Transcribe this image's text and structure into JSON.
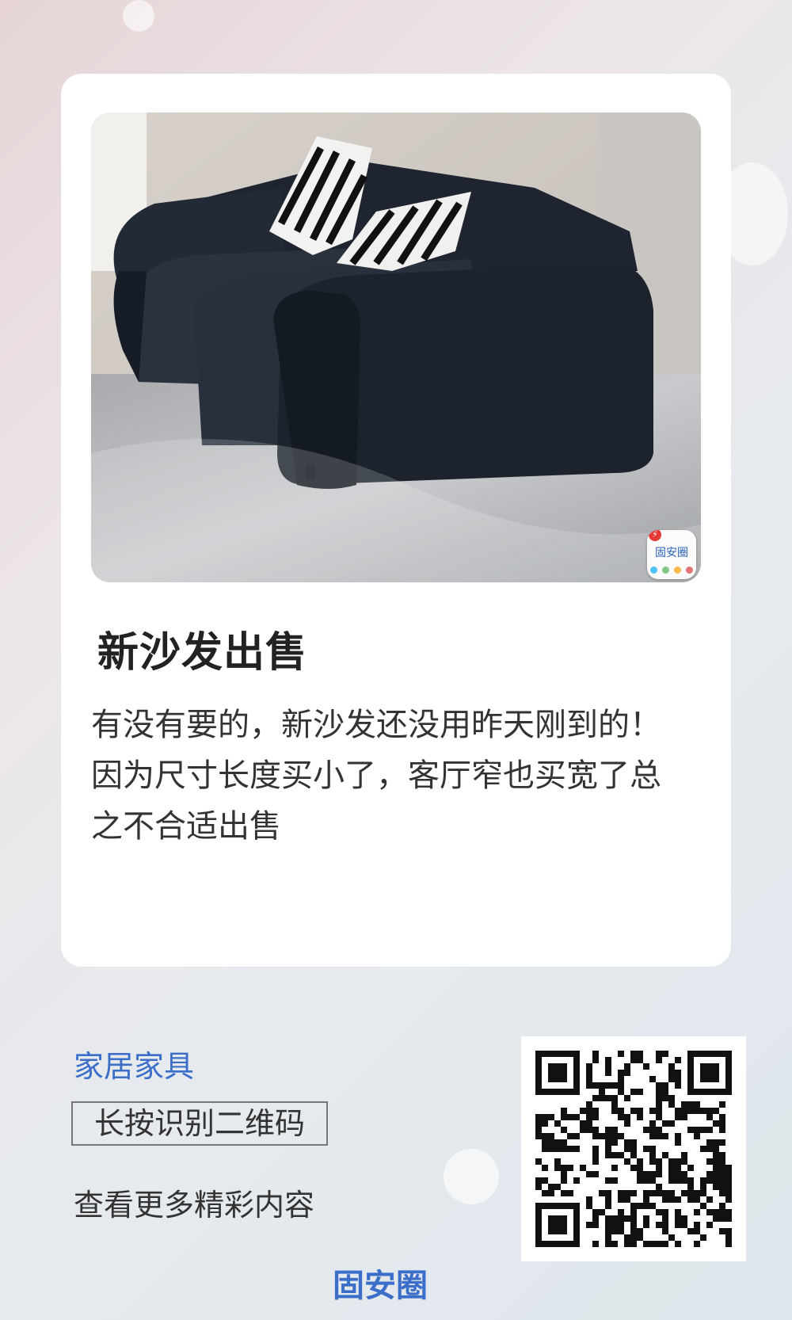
{
  "post": {
    "title": "新沙发出售",
    "description": "有没有要的，新沙发还没用昨天刚到的！因为尺寸长度买小了，客厅窄也买宽了总之不合适出售",
    "image_alt": "black leather sofa with zebra-print cushions"
  },
  "watermark": {
    "app_name": "固安圈"
  },
  "footer": {
    "category": "家居家具",
    "scan_hint": "长按识别二维码",
    "more_text": "查看更多精彩内容",
    "brand": "固安圈"
  },
  "colors": {
    "accent": "#3b6ec8",
    "title": "#222222",
    "card_bg": "#ffffff"
  }
}
